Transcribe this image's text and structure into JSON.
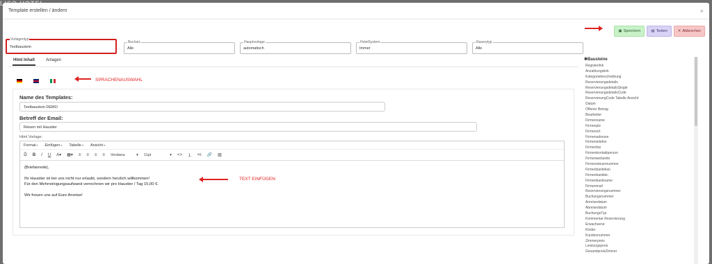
{
  "background_brand": "LISO HOTEL",
  "modal": {
    "title": "Template erstellen / ändern",
    "close": "×"
  },
  "buttons": {
    "save": "Speichern",
    "texts": "Texten",
    "cancel": "Abbrechen",
    "save_icon": "floppy-icon",
    "texts_icon": "card-icon",
    "cancel_icon": "x-icon"
  },
  "filters": [
    {
      "label": "Vorlagentyp",
      "value": "Textbaustein"
    },
    {
      "label": "Buchart",
      "value": "Alle"
    },
    {
      "label": "Hauptvorlage",
      "value": "automatisch"
    },
    {
      "label": "HotelSystem",
      "value": "Immer"
    },
    {
      "label": "Raserytyp",
      "value": "Alle"
    }
  ],
  "tabs": [
    "Html Inhalt",
    "Anlagen"
  ],
  "languages": [
    "de",
    "en",
    "it"
  ],
  "annotations": {
    "lang": "SPRACHENAUSWAHL",
    "text": "TEXT EINFÜGEN"
  },
  "form": {
    "name_heading": "Name des Templates:",
    "name_value": "Textbaustein DEMO",
    "subject_heading": "Betreff der Email:",
    "subject_value": "Reisen mit Haustier",
    "html_label": "Html Vorlage:"
  },
  "editor": {
    "menu": [
      "Format",
      "Einfügen",
      "Tabelle",
      "Ansicht"
    ],
    "font": "Verdana",
    "size": "11pt",
    "lines": [
      "{Briefanrede},",
      "",
      "Ihr Haustier ist bei uns nicht nur erlaubt, sondern herzlich willkommen!",
      "Für den Mehrreinigungsaufwand verrechnen wir pro Haustier / Tag 15,00 €.",
      "",
      "Wir freuen uns auf Eure Anreise!"
    ]
  },
  "sidebar": {
    "title": "Bausteine",
    "items": [
      "Registerlink",
      "Anzahlungslink",
      "Kategoriebeschreibung",
      "Reservierungsdetails",
      "ReservierungsdetailsSingle",
      "ReservierungsdetailsCode",
      "ReservierungCode Tabelle Ansicht",
      "Datum",
      "Offener Betrag",
      "Bearbeiter",
      "Firmenname",
      "Firmenplz",
      "Firmenort",
      "Firmenadresse",
      "Firmentelefon",
      "Firmenfax",
      "Firmenkontaktperson",
      "Firmenwebseite",
      "Firmensteuernummer",
      "Firmenbanktkan",
      "Firmenbankbic",
      "Firmenbankname",
      "Firmenmail",
      "Reservierungsnummer",
      "Buchungsnummer",
      "Anreisedatum",
      "Abreisedatum",
      "BuchungsTyp",
      "Kommentar Reservierung",
      "Erwachsene",
      "Kinder",
      "Kundennummer",
      "Zimmerpreis",
      "Leistungspreis",
      "GesamtpreisZimmer"
    ]
  }
}
